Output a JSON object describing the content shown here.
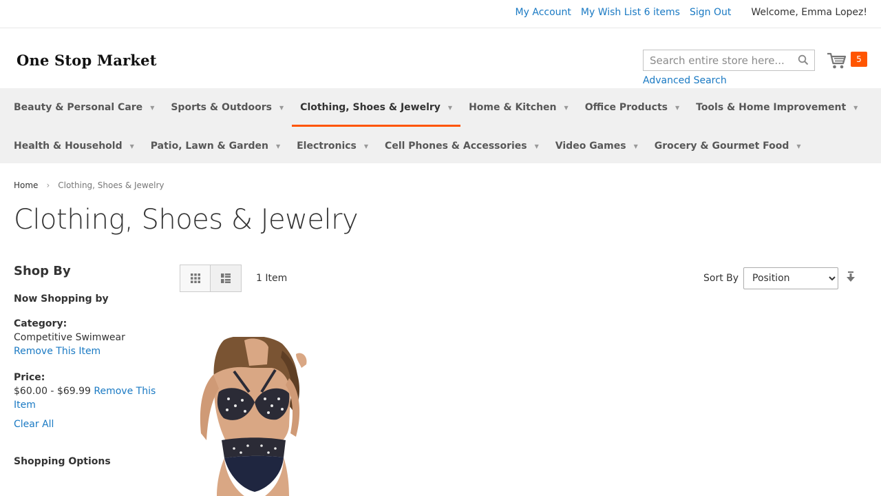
{
  "header": {
    "links": [
      "My Account",
      "My Wish List 6 items",
      "Sign Out"
    ],
    "welcome": "Welcome, Emma Lopez!",
    "logo": "One Stop Market",
    "search_placeholder": "Search entire store here...",
    "advanced_search": "Advanced Search",
    "cart_count": "5"
  },
  "nav": {
    "row1": [
      {
        "label": "Beauty & Personal Care"
      },
      {
        "label": "Sports & Outdoors"
      },
      {
        "label": "Clothing, Shoes & Jewelry",
        "active": true
      },
      {
        "label": "Home & Kitchen"
      },
      {
        "label": "Office Products"
      },
      {
        "label": "Tools & Home Improvement"
      }
    ],
    "row2": [
      {
        "label": "Health & Household"
      },
      {
        "label": "Patio, Lawn & Garden"
      },
      {
        "label": "Electronics"
      },
      {
        "label": "Cell Phones & Accessories"
      },
      {
        "label": "Video Games"
      },
      {
        "label": "Grocery & Gourmet Food"
      }
    ]
  },
  "breadcrumb": {
    "home": "Home",
    "current": "Clothing, Shoes & Jewelry"
  },
  "page_title": "Clothing, Shoes & Jewelry",
  "sidebar": {
    "shop_by": "Shop By",
    "now_shopping": "Now Shopping by",
    "filters": [
      {
        "label": "Category:",
        "value": "Competitive Swimwear",
        "remove": "Remove This Item"
      },
      {
        "label": "Price:",
        "value": "$60.00 - $69.99",
        "remove": "Remove This Item"
      }
    ],
    "clear_all": "Clear All",
    "shopping_options": "Shopping Options"
  },
  "toolbar": {
    "item_count": "1 Item",
    "sort_label": "Sort By",
    "sort_value": "Position"
  },
  "colors": {
    "accent": "#ff5501",
    "link": "#1979c3",
    "nav_bg": "#f0f0f0"
  }
}
